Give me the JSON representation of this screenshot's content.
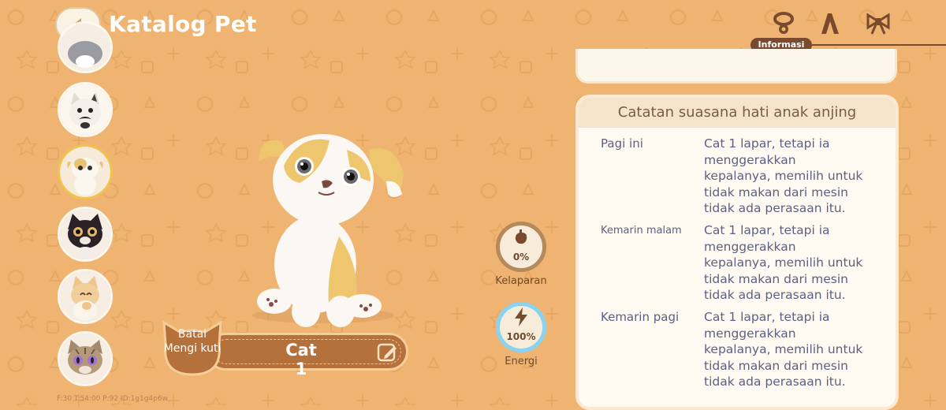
{
  "header": {
    "title": "Katalog Pet",
    "back_icon": "back-arrow-icon",
    "tabs": [
      {
        "icon": "collar-icon",
        "label": "Informasi",
        "active": true
      },
      {
        "icon": "hat-icon"
      },
      {
        "icon": "bow-icon"
      }
    ]
  },
  "sidebar": {
    "pets": [
      {
        "icon": "cat-gray-avatar-icon"
      },
      {
        "icon": "cat-white-mustache-avatar-icon"
      },
      {
        "icon": "puppy-calico-avatar-icon",
        "selected": true
      },
      {
        "icon": "cat-black-avatar-icon"
      },
      {
        "icon": "cat-cream-avatar-icon"
      },
      {
        "icon": "cat-tabby-avatar-icon"
      }
    ],
    "debug_text": "F:30   T:54:00   P:92   ID:1g1g4p6w"
  },
  "pet": {
    "name": "Cat 1",
    "release_label": "Batal Mengi kuti",
    "edit_icon": "edit-pencil-icon"
  },
  "status": {
    "hunger": {
      "value": "0%",
      "label": "Kelaparan",
      "fill": 0.0,
      "icon": "stomach-icon",
      "color": "#b5895b"
    },
    "energy": {
      "value": "100%",
      "label": "Energi",
      "fill": 1.0,
      "icon": "lightning-icon",
      "color": "#8ad2f2"
    }
  },
  "mood_log": {
    "title": "Catatan suasana hati anak anjing",
    "entries": [
      {
        "time": "Pagi ini",
        "lines": [
          "Cat 1 lapar, tetapi ia",
          "menggerakkan",
          "kepalanya, memilih untuk",
          "tidak makan dari mesin",
          "tidak ada perasaan itu."
        ]
      },
      {
        "time": "Kemarin malam",
        "lines": [
          "Cat 1 lapar, tetapi ia",
          "menggerakkan",
          "kepalanya, memilih untuk",
          "tidak makan dari mesin",
          "tidak ada perasaan itu."
        ]
      },
      {
        "time": "Kemarin pagi",
        "lines": [
          "Cat 1 lapar, tetapi ia",
          "menggerakkan",
          "kepalanya, memilih untuk",
          "tidak makan dari mesin",
          "tidak ada perasaan itu."
        ]
      }
    ]
  },
  "colors": {
    "background": "#efb472",
    "accent_brown": "#b5713c",
    "text_blue": "#5d6083"
  }
}
